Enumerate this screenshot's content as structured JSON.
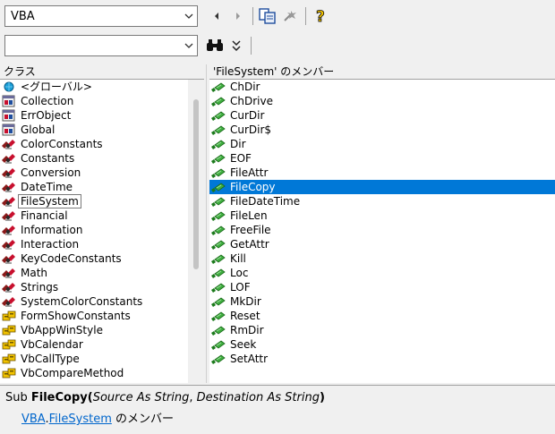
{
  "toolbar": {
    "library_value": "VBA",
    "search_value": "",
    "icons": [
      "back-arrow-icon",
      "forward-arrow-icon",
      "copy-icon",
      "view-definition-icon",
      "help-icon",
      "binoculars-icon",
      "toggle-results-icon"
    ]
  },
  "classes_header": "クラス",
  "members_header": "'FileSystem' のメンバー",
  "classes": [
    {
      "label": "<グローバル>",
      "icon": "globe"
    },
    {
      "label": "Collection",
      "icon": "class"
    },
    {
      "label": "ErrObject",
      "icon": "class"
    },
    {
      "label": "Global",
      "icon": "class"
    },
    {
      "label": "ColorConstants",
      "icon": "module"
    },
    {
      "label": "Constants",
      "icon": "module"
    },
    {
      "label": "Conversion",
      "icon": "module"
    },
    {
      "label": "DateTime",
      "icon": "module"
    },
    {
      "label": "FileSystem",
      "icon": "module"
    },
    {
      "label": "Financial",
      "icon": "module"
    },
    {
      "label": "Information",
      "icon": "module"
    },
    {
      "label": "Interaction",
      "icon": "module"
    },
    {
      "label": "KeyCodeConstants",
      "icon": "module"
    },
    {
      "label": "Math",
      "icon": "module"
    },
    {
      "label": "Strings",
      "icon": "module"
    },
    {
      "label": "SystemColorConstants",
      "icon": "module"
    },
    {
      "label": "FormShowConstants",
      "icon": "enum"
    },
    {
      "label": "VbAppWinStyle",
      "icon": "enum"
    },
    {
      "label": "VbCalendar",
      "icon": "enum"
    },
    {
      "label": "VbCallType",
      "icon": "enum"
    },
    {
      "label": "VbCompareMethod",
      "icon": "enum"
    }
  ],
  "members": [
    "ChDir",
    "ChDrive",
    "CurDir",
    "CurDir$",
    "Dir",
    "EOF",
    "FileAttr",
    "FileCopy",
    "FileDateTime",
    "FileLen",
    "FreeFile",
    "GetAttr",
    "Kill",
    "Loc",
    "LOF",
    "MkDir",
    "Reset",
    "RmDir",
    "Seek",
    "SetAttr"
  ],
  "details": {
    "prefix": "Sub ",
    "name": "FileCopy(",
    "param1": "Source As String",
    "sep": ", ",
    "param2": "Destination As String",
    "close": ")",
    "lib_link": "VBA",
    "dot": ".",
    "class_link": "FileSystem",
    "suffix": " のメンバー"
  },
  "colors": {
    "selection": "#0078d7",
    "link": "#0066cc"
  }
}
